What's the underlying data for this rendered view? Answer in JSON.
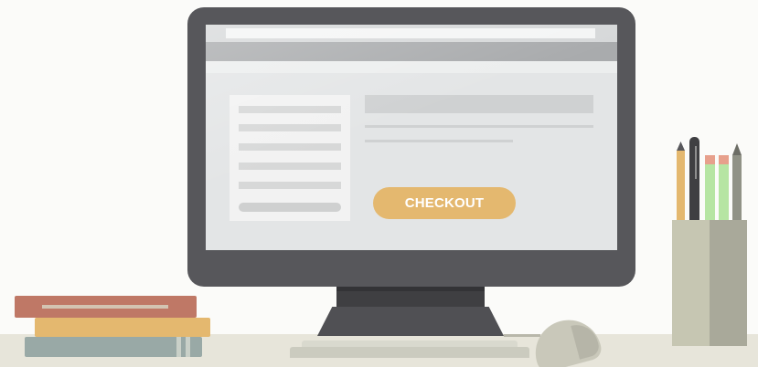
{
  "screen": {
    "checkout_button_label": "CHECKOUT"
  },
  "colors": {
    "background": "#fbfbf9",
    "monitor_frame": "#57575b",
    "screen_background": "#e3e5e6",
    "checkout_button": "#e4b86f",
    "desk": "#e7e5da"
  },
  "icons": {
    "monitor": "monitor-icon",
    "books": "books-icon",
    "mouse": "mouse-icon",
    "pen_holder": "pen-holder-icon"
  }
}
